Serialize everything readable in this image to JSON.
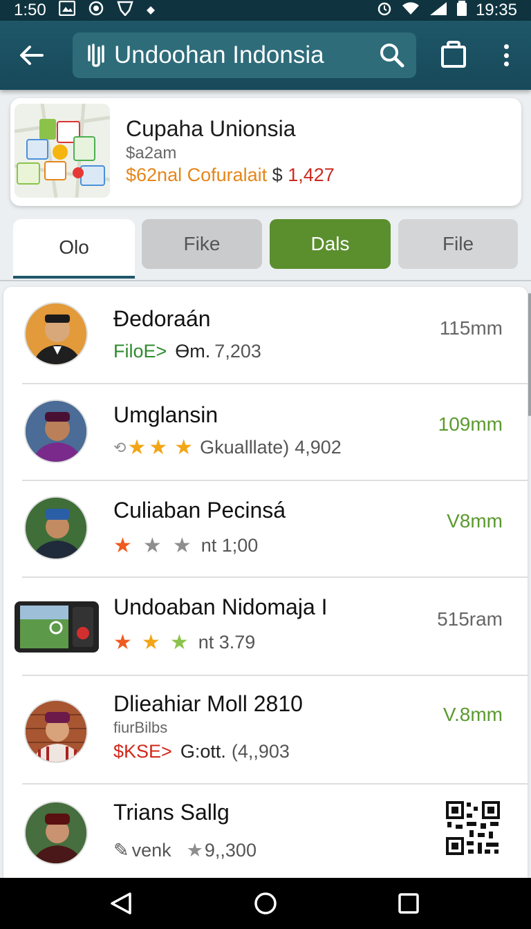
{
  "status_bar": {
    "time_left": "1:50",
    "time_right": "19:35"
  },
  "app_bar": {
    "search_title": "Undoohan Indonsia",
    "icons": [
      "back-arrow-icon",
      "logo-icon",
      "search-icon",
      "cart-icon",
      "more-vert-icon"
    ]
  },
  "header_card": {
    "title": "Cupaha Unionsia",
    "subtitle": "$a2am",
    "price_orange": "$62nal Cofuralait",
    "price_currency": "$",
    "price_red": "1,427"
  },
  "tabs": [
    {
      "label": "Olo",
      "active": true
    },
    {
      "label": "Fike",
      "active": false
    },
    {
      "label": "Dals",
      "active": false
    },
    {
      "label": "File",
      "active": false
    }
  ],
  "items": [
    {
      "title": "Đedoraán",
      "tag": "FiloE>",
      "meta_bold": "Ɵm.",
      "meta_count": "7,203",
      "distance": "115mm"
    },
    {
      "title": "Umglansin",
      "rating_label": "Gkualllate)",
      "meta_count": "4,902",
      "distance": "109mm",
      "rating_stars": 3
    },
    {
      "title": "Culiaban Pecinsá",
      "meta_count": "nt 1;00",
      "distance": "V8mm",
      "rating_stars": 1
    },
    {
      "title": "Undoaban Nidomaja I",
      "meta_count": "nt 3.79",
      "distance": "515ram",
      "rating_stars": 3
    },
    {
      "title": "Dlieahiar Moll 2810",
      "subtitle": "fiurBilbs",
      "tag": "$KSE>",
      "meta_bold": "G:ott.",
      "meta_count": "(4,,903",
      "distance": "V.8mm"
    },
    {
      "title": "Trians Sallg",
      "meta_label": "venk",
      "meta_count": "9,,300"
    }
  ]
}
